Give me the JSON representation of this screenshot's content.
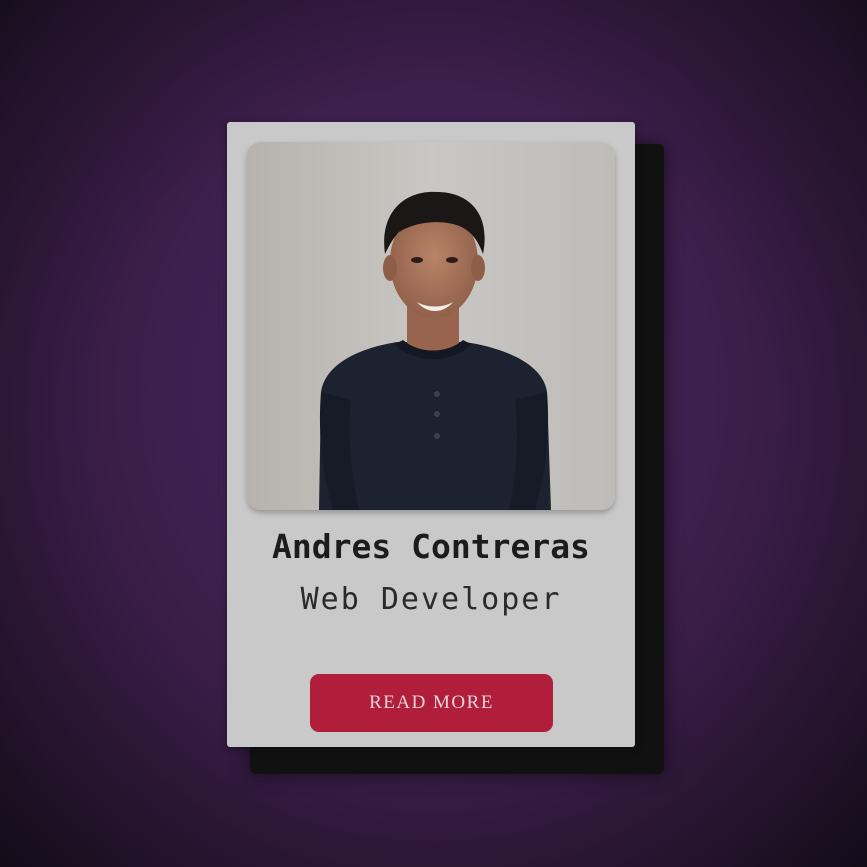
{
  "profile_card": {
    "name": "Andres Contreras",
    "role": "Web Developer",
    "button_label": "READ MORE",
    "photo": "profile-photo"
  },
  "colors": {
    "background": "#3e1f4e",
    "card": "#c9c9c9",
    "button": "#b01e3b",
    "button_text": "#e8d4d8"
  }
}
